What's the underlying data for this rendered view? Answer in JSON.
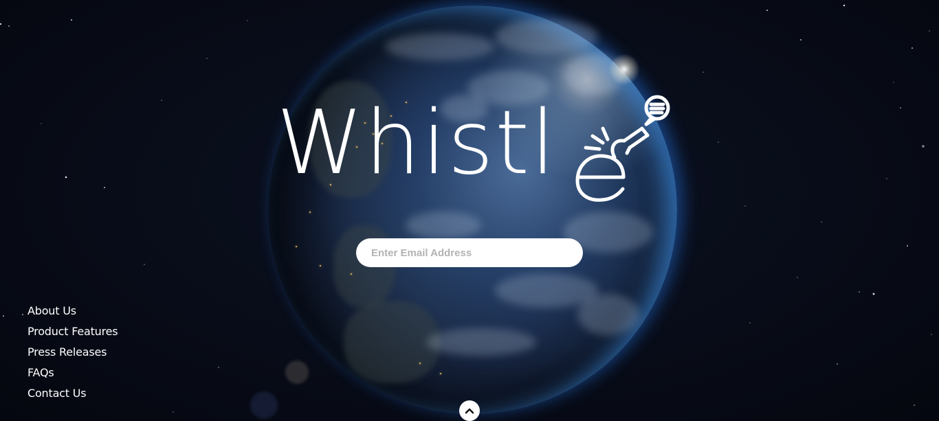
{
  "brand": {
    "name": "Whistle",
    "logo_text": "Whistl",
    "icon": "whistle-chat-icon"
  },
  "signup": {
    "email_placeholder": "Enter Email Address",
    "email_value": ""
  },
  "footer_nav": {
    "items": [
      {
        "label": "About Us"
      },
      {
        "label": "Product Features"
      },
      {
        "label": "Press Releases"
      },
      {
        "label": "FAQs"
      },
      {
        "label": "Contact Us"
      }
    ]
  },
  "scroll_top": {
    "icon": "chevron-up-icon"
  },
  "colors": {
    "background": "#070b16",
    "text": "#ffffff",
    "placeholder": "#b3b3b3",
    "atmosphere": "#3ea2ff"
  }
}
